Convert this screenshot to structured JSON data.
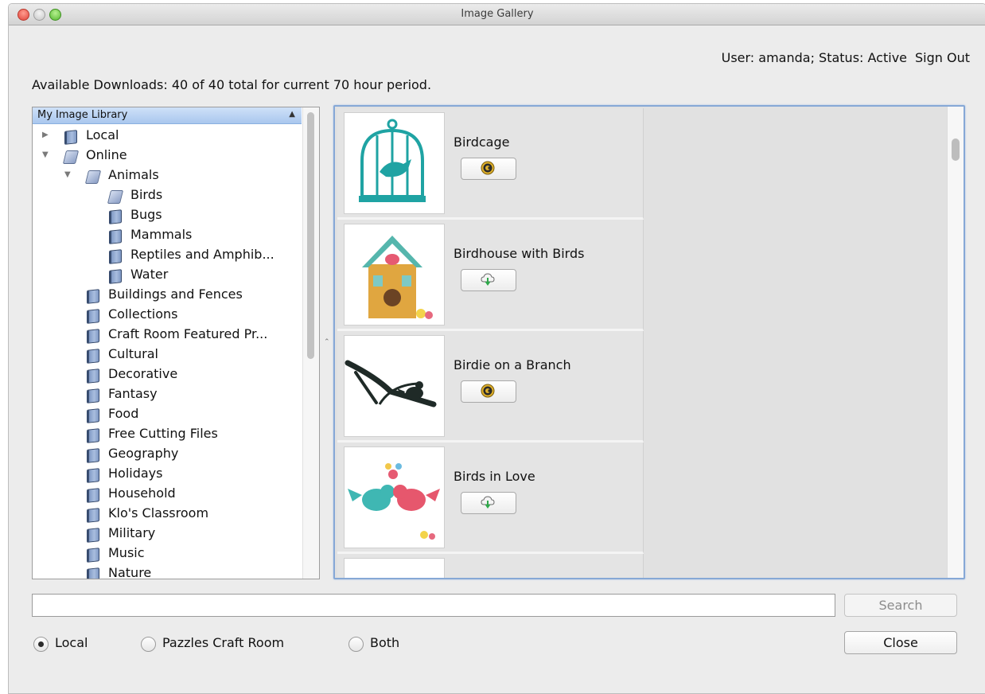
{
  "window": {
    "title": "Image Gallery"
  },
  "user": {
    "status_text": "User: amanda; Status: Active",
    "signout_label": "Sign Out"
  },
  "downloads_text": "Available Downloads: 40 of 40 total for current 70 hour period.",
  "tree": {
    "header": "My Image Library",
    "items": [
      {
        "label": "Local",
        "expanded": false
      },
      {
        "label": "Online",
        "expanded": true
      },
      {
        "label": "Animals",
        "expanded": true
      },
      {
        "label": "Birds",
        "selected": true
      },
      {
        "label": "Bugs"
      },
      {
        "label": "Mammals"
      },
      {
        "label": "Reptiles and Amphib..."
      },
      {
        "label": "Water"
      },
      {
        "label": "Buildings and Fences"
      },
      {
        "label": "Collections"
      },
      {
        "label": "Craft Room Featured Pr..."
      },
      {
        "label": "Cultural"
      },
      {
        "label": "Decorative"
      },
      {
        "label": "Fantasy"
      },
      {
        "label": "Food"
      },
      {
        "label": "Free Cutting Files"
      },
      {
        "label": "Geography"
      },
      {
        "label": "Holidays"
      },
      {
        "label": "Household"
      },
      {
        "label": "Klo's Classroom"
      },
      {
        "label": "Military"
      },
      {
        "label": "Music"
      },
      {
        "label": "Nature"
      }
    ]
  },
  "images": [
    {
      "name": "Birdcage",
      "action_icon": "coin-c-icon"
    },
    {
      "name": "Birdhouse with Birds",
      "action_icon": "cloud-download-icon"
    },
    {
      "name": "Birdie on a Branch",
      "action_icon": "coin-c-icon"
    },
    {
      "name": "Birds in Love",
      "action_icon": "cloud-download-icon"
    }
  ],
  "search": {
    "value": "",
    "button_label": "Search"
  },
  "radios": [
    {
      "label": "Local",
      "selected": true
    },
    {
      "label": "Pazzles Craft Room",
      "selected": false
    },
    {
      "label": "Both",
      "selected": false
    }
  ],
  "close_label": "Close",
  "colors": {
    "teal": "#1fa3a3",
    "selection_blue": "#a9c7ee",
    "focus_ring": "#86a8d6"
  }
}
